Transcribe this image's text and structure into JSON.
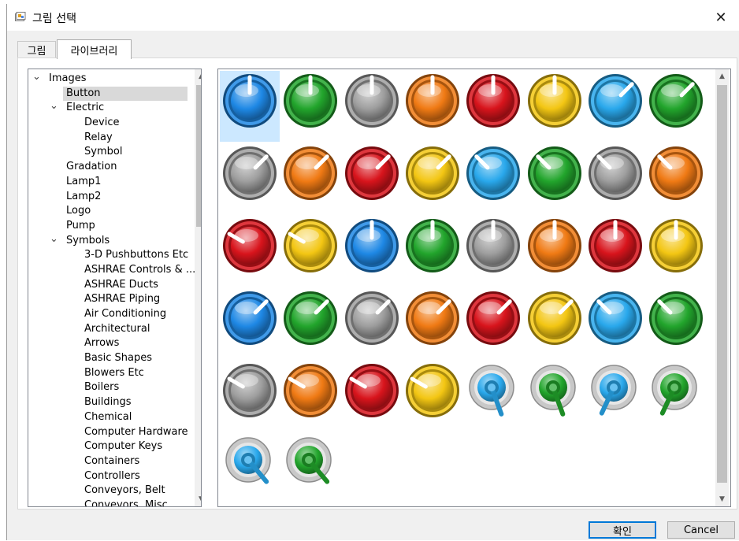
{
  "window": {
    "title": "그림 선택",
    "icon": "app-icon",
    "close_glyph": "✕"
  },
  "tabs": [
    {
      "label": "그림",
      "active": false
    },
    {
      "label": "라이브러리",
      "active": true
    }
  ],
  "tree": {
    "items": [
      {
        "label": "Images",
        "level": 0,
        "expander": "expanded",
        "selected": false
      },
      {
        "label": "Button",
        "level": 1,
        "expander": "none",
        "selected": true
      },
      {
        "label": "Electric",
        "level": 1,
        "expander": "expanded",
        "selected": false
      },
      {
        "label": "Device",
        "level": 2,
        "expander": "none",
        "selected": false
      },
      {
        "label": "Relay",
        "level": 2,
        "expander": "none",
        "selected": false
      },
      {
        "label": "Symbol",
        "level": 2,
        "expander": "none",
        "selected": false
      },
      {
        "label": "Gradation",
        "level": 1,
        "expander": "none",
        "selected": false
      },
      {
        "label": "Lamp1",
        "level": 1,
        "expander": "none",
        "selected": false
      },
      {
        "label": "Lamp2",
        "level": 1,
        "expander": "none",
        "selected": false
      },
      {
        "label": "Logo",
        "level": 1,
        "expander": "none",
        "selected": false
      },
      {
        "label": "Pump",
        "level": 1,
        "expander": "none",
        "selected": false
      },
      {
        "label": "Symbols",
        "level": 1,
        "expander": "expanded",
        "selected": false
      },
      {
        "label": "3-D Pushbuttons Etc",
        "level": 2,
        "expander": "none",
        "selected": false
      },
      {
        "label": "ASHRAE Controls & ...",
        "level": 2,
        "expander": "none",
        "selected": false
      },
      {
        "label": "ASHRAE Ducts",
        "level": 2,
        "expander": "none",
        "selected": false
      },
      {
        "label": "ASHRAE Piping",
        "level": 2,
        "expander": "none",
        "selected": false
      },
      {
        "label": "Air Conditioning",
        "level": 2,
        "expander": "none",
        "selected": false
      },
      {
        "label": "Architectural",
        "level": 2,
        "expander": "none",
        "selected": false
      },
      {
        "label": "Arrows",
        "level": 2,
        "expander": "none",
        "selected": false
      },
      {
        "label": "Basic Shapes",
        "level": 2,
        "expander": "none",
        "selected": false
      },
      {
        "label": "Blowers Etc",
        "level": 2,
        "expander": "none",
        "selected": false
      },
      {
        "label": "Boilers",
        "level": 2,
        "expander": "none",
        "selected": false
      },
      {
        "label": "Buildings",
        "level": 2,
        "expander": "none",
        "selected": false
      },
      {
        "label": "Chemical",
        "level": 2,
        "expander": "none",
        "selected": false
      },
      {
        "label": "Computer Hardware",
        "level": 2,
        "expander": "none",
        "selected": false
      },
      {
        "label": "Computer Keys",
        "level": 2,
        "expander": "none",
        "selected": false
      },
      {
        "label": "Containers",
        "level": 2,
        "expander": "none",
        "selected": false
      },
      {
        "label": "Controllers",
        "level": 2,
        "expander": "none",
        "selected": false
      },
      {
        "label": "Conveyors, Belt",
        "level": 2,
        "expander": "none",
        "selected": false
      },
      {
        "label": "Conveyors, Misc",
        "level": 2,
        "expander": "none",
        "selected": false
      }
    ],
    "scroll_up_glyph": "▲",
    "scroll_down_glyph": "▼"
  },
  "gallery": {
    "selected_index": 0,
    "colors": {
      "blue": "#1e88e5",
      "green": "#22a52c",
      "gray": "#9e9e9e",
      "orange": "#f07a14",
      "red": "#d8141c",
      "yellow": "#f3c613",
      "sky": "#29a8ec"
    },
    "items": [
      {
        "type": "knob",
        "color": "blue",
        "angle": 0
      },
      {
        "type": "knob",
        "color": "green",
        "angle": 0
      },
      {
        "type": "knob",
        "color": "gray",
        "angle": 0
      },
      {
        "type": "knob",
        "color": "orange",
        "angle": 0
      },
      {
        "type": "knob",
        "color": "red",
        "angle": 0
      },
      {
        "type": "knob",
        "color": "yellow",
        "angle": 0
      },
      {
        "type": "knob",
        "color": "sky",
        "angle": 45
      },
      {
        "type": "knob",
        "color": "green",
        "angle": 45
      },
      {
        "type": "knob",
        "color": "gray",
        "angle": 45
      },
      {
        "type": "knob",
        "color": "orange",
        "angle": 45
      },
      {
        "type": "knob",
        "color": "red",
        "angle": 45
      },
      {
        "type": "knob",
        "color": "yellow",
        "angle": 45
      },
      {
        "type": "knob",
        "color": "sky",
        "angle": -45
      },
      {
        "type": "knob",
        "color": "green",
        "angle": -45
      },
      {
        "type": "knob",
        "color": "gray",
        "angle": -45
      },
      {
        "type": "knob",
        "color": "orange",
        "angle": -45
      },
      {
        "type": "knob",
        "color": "red",
        "angle": -60
      },
      {
        "type": "knob",
        "color": "yellow",
        "angle": -60
      },
      {
        "type": "knob",
        "color": "blue",
        "angle": 0
      },
      {
        "type": "knob",
        "color": "green",
        "angle": 0
      },
      {
        "type": "knob",
        "color": "gray",
        "angle": 0
      },
      {
        "type": "knob",
        "color": "orange",
        "angle": 0
      },
      {
        "type": "knob",
        "color": "red",
        "angle": 0
      },
      {
        "type": "knob",
        "color": "yellow",
        "angle": 0
      },
      {
        "type": "knob",
        "color": "blue",
        "angle": 45
      },
      {
        "type": "knob",
        "color": "green",
        "angle": 45
      },
      {
        "type": "knob",
        "color": "gray",
        "angle": 45
      },
      {
        "type": "knob",
        "color": "orange",
        "angle": 45
      },
      {
        "type": "knob",
        "color": "red",
        "angle": 45
      },
      {
        "type": "knob",
        "color": "yellow",
        "angle": 45
      },
      {
        "type": "knob",
        "color": "sky",
        "angle": -45
      },
      {
        "type": "knob",
        "color": "green",
        "angle": -45
      },
      {
        "type": "knob",
        "color": "gray",
        "angle": -60
      },
      {
        "type": "knob",
        "color": "orange",
        "angle": -60
      },
      {
        "type": "knob",
        "color": "red",
        "angle": -60
      },
      {
        "type": "knob",
        "color": "yellow",
        "angle": -60
      },
      {
        "type": "toggle",
        "color": "sky",
        "angle": 20
      },
      {
        "type": "toggle",
        "color": "green",
        "angle": 20
      },
      {
        "type": "toggle",
        "color": "sky",
        "angle": -25
      },
      {
        "type": "toggle",
        "color": "green",
        "angle": -25
      },
      {
        "type": "toggle",
        "color": "sky",
        "angle": 40
      },
      {
        "type": "toggle",
        "color": "green",
        "angle": 40
      }
    ],
    "scroll_up_glyph": "▲",
    "scroll_down_glyph": "▼"
  },
  "buttons": {
    "ok_label": "확인",
    "cancel_label": "Cancel"
  }
}
